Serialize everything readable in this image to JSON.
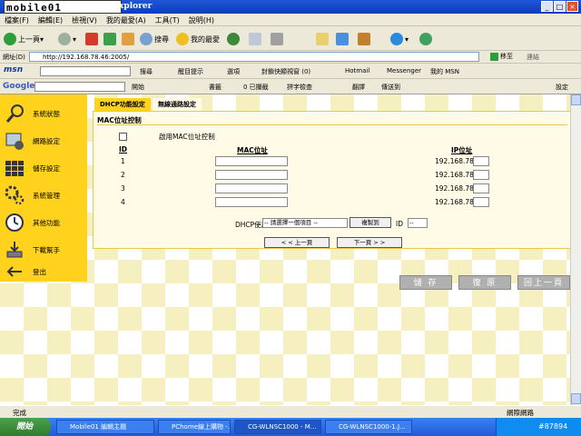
{
  "window": {
    "title_fragment": "ternet Explorer",
    "logo": "mobile01"
  },
  "menubar": [
    "檔案(F)",
    "編輯(E)",
    "檢視(V)",
    "我的最愛(A)",
    "工具(T)",
    "說明(H)"
  ],
  "toolbar": {
    "back": "上一頁",
    "search": "搜尋",
    "favorites": "我的最愛"
  },
  "address": {
    "label": "網址(D)",
    "url": "http://192.168.78.46:2005/",
    "go": "移至",
    "links": "連結"
  },
  "msnbar": {
    "brand": "msn",
    "search": "搜尋",
    "alerts": "醒目提示",
    "options": "選項",
    "popup": "封鎖快顯視窗 (0)",
    "hotmail": "Hotmail",
    "messenger": "Messenger",
    "mymsn": "我的 MSN"
  },
  "googlebar": {
    "brand": "Google",
    "start": "開始",
    "bookmarks": "書籤",
    "blocked": "0 已攔截",
    "spell": "拼字檢查",
    "translate": "翻譯",
    "send": "傳送到",
    "settings": "設定"
  },
  "sidebar": [
    {
      "label": "系統狀態",
      "icon": "magnifier-icon"
    },
    {
      "label": "網路設定",
      "icon": "network-icon"
    },
    {
      "label": "儲存設定",
      "icon": "storage-icon"
    },
    {
      "label": "系統管理",
      "icon": "gears-icon"
    },
    {
      "label": "其他功能",
      "icon": "clock-icon"
    },
    {
      "label": "下載幫手",
      "icon": "download-icon"
    },
    {
      "label": "登出",
      "icon": "logout-arrow-icon"
    }
  ],
  "tabs": [
    "DHCP功能設定",
    "無線通路設定"
  ],
  "panel": {
    "title": "MAC位址控制",
    "enable_label": "啟用MAC位址控制",
    "headers": {
      "id": "ID",
      "mac": "MAC位址",
      "ip": "IP位址"
    },
    "rows": [
      {
        "id": "1",
        "mac": "",
        "ip_prefix": "192.168.78.",
        "ip_last": ""
      },
      {
        "id": "2",
        "mac": "",
        "ip_prefix": "192.168.78.",
        "ip_last": ""
      },
      {
        "id": "3",
        "mac": "",
        "ip_prefix": "192.168.78.",
        "ip_last": ""
      },
      {
        "id": "4",
        "mac": "",
        "ip_prefix": "192.168.78.",
        "ip_last": ""
      }
    ],
    "dhcp_user_label": "DHCP使用者",
    "dhcp_user_select": "-- 請選擇一個項目 --",
    "copy_button": "複製到",
    "id_label": "ID",
    "id_select": "--",
    "prev_page": "< < 上一頁",
    "next_page": "下一頁 > >"
  },
  "actions": {
    "save": "儲 存",
    "restore": "復 原",
    "back": "回上一頁"
  },
  "status": {
    "text": "完成",
    "zone": "網際網路"
  },
  "taskbar": {
    "start": "開始",
    "tasks": [
      "Mobile01 編輯主題",
      "PChome線上購物 -...",
      "CG-WLNSC1000 - M...",
      "CG-WLNSC1000-1.J..."
    ],
    "clock": "#87894"
  }
}
